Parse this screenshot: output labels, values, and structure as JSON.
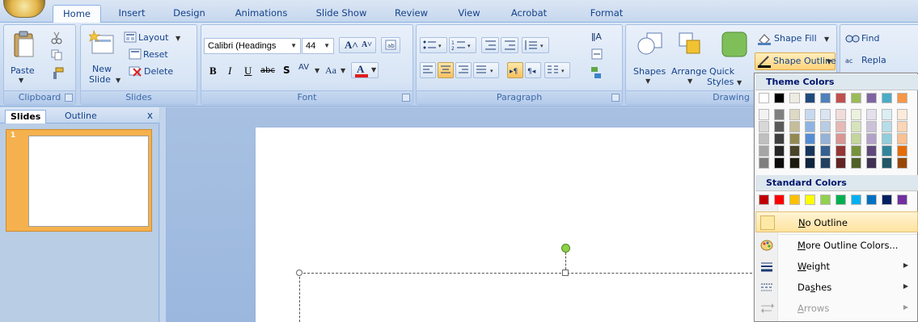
{
  "tabs": [
    "Home",
    "Insert",
    "Design",
    "Animations",
    "Slide Show",
    "Review",
    "View",
    "Acrobat",
    "Format"
  ],
  "clipboard": {
    "label": "Clipboard",
    "paste": "Paste"
  },
  "slides": {
    "label": "Slides",
    "layout": "Layout",
    "reset": "Reset",
    "new_slide_1": "New",
    "new_slide_2": "Slide",
    "delete": "Delete"
  },
  "font": {
    "label": "Font",
    "name": "Calibri (Headings",
    "size": "44"
  },
  "paragraph": {
    "label": "Paragraph"
  },
  "drawing": {
    "label": "Drawing",
    "shapes": "Shapes",
    "arrange": "Arrange",
    "quick_styles_1": "Quick",
    "quick_styles_2": "Styles",
    "shape_fill": "Shape Fill",
    "shape_outline": "Shape Outline"
  },
  "editing": {
    "find": "Find",
    "replace": "Repla"
  },
  "pane": {
    "tab_slides": "Slides",
    "tab_outline": "Outline",
    "close": "x",
    "slide_number": "1"
  },
  "menu": {
    "theme_colors_title": "Theme Colors",
    "standard_colors_title": "Standard Colors",
    "items": [
      {
        "label": "No Outline",
        "access": "N",
        "rest": "o Outline"
      },
      {
        "label": "More Outline Colors...",
        "access": "M",
        "rest": "ore Outline Colors..."
      },
      {
        "label": "Weight",
        "access": "W",
        "rest": "eight"
      },
      {
        "label": "Dashes",
        "access": "s",
        "pre": "Da",
        "rest": "hes"
      },
      {
        "label": "Arrows",
        "access": "A",
        "rest": "rrows"
      }
    ],
    "theme_top_row": [
      "#ffffff",
      "#000000",
      "#eeece1",
      "#1f497d",
      "#4f81bd",
      "#c0504d",
      "#9bbb59",
      "#8064a2",
      "#4bacc6",
      "#f79646"
    ],
    "theme_shades": [
      [
        "#f2f2f2",
        "#d8d8d8",
        "#bfbfbf",
        "#a5a5a5",
        "#7f7f7f"
      ],
      [
        "#7f7f7f",
        "#595959",
        "#3f3f3f",
        "#262626",
        "#0c0c0c"
      ],
      [
        "#ddd9c3",
        "#c4bd97",
        "#938953",
        "#494429",
        "#1d1b10"
      ],
      [
        "#c6d9f0",
        "#8db3e2",
        "#548dd4",
        "#17365d",
        "#0f243e"
      ],
      [
        "#dbe5f1",
        "#b8cce4",
        "#95b3d7",
        "#366092",
        "#244061"
      ],
      [
        "#f2dcdb",
        "#e5b9b7",
        "#d99694",
        "#953734",
        "#632423"
      ],
      [
        "#ebf1dd",
        "#d7e3bc",
        "#c3d69b",
        "#76923c",
        "#4f6128"
      ],
      [
        "#e5e0ec",
        "#ccc1d9",
        "#b2a2c7",
        "#5f497a",
        "#3f3151"
      ],
      [
        "#dbeef3",
        "#b7dde8",
        "#92cddc",
        "#31859b",
        "#205867"
      ],
      [
        "#fdeada",
        "#fbd5b5",
        "#fac08f",
        "#e36c09",
        "#974806"
      ]
    ],
    "standard_colors": [
      "#c00000",
      "#ff0000",
      "#ffc000",
      "#ffff00",
      "#92d050",
      "#00b050",
      "#00b0f0",
      "#0070c0",
      "#002060",
      "#7030a0"
    ]
  }
}
